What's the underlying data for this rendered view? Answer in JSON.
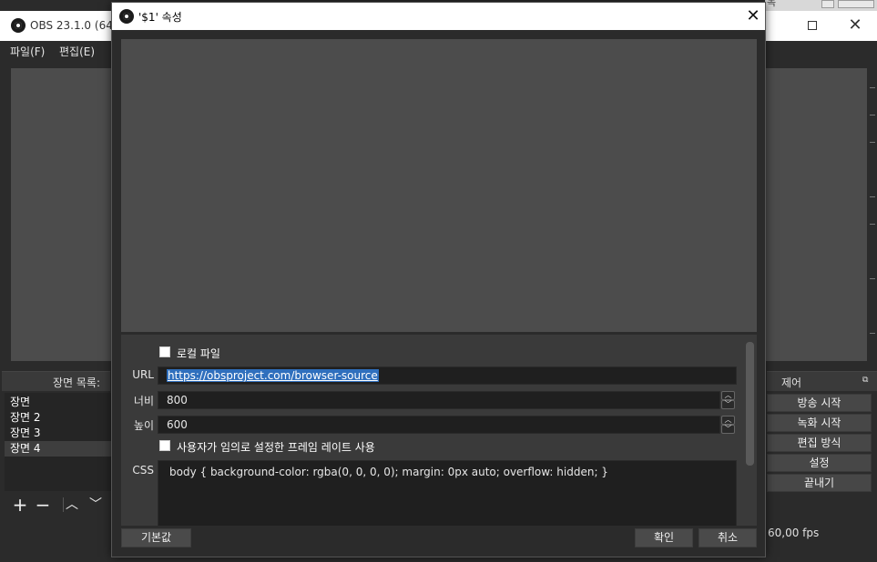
{
  "main_window": {
    "title": "OBS 23.1.0 (64-",
    "menu": [
      "파일(F)",
      "편집(E)"
    ],
    "top_right_partial": "녹",
    "scenes_panel": {
      "title": "장면 목록:",
      "items": [
        "장면",
        "장면 2",
        "장면 3",
        "장면 4"
      ],
      "selected_index": 3,
      "toolbar": {
        "add": "+",
        "remove": "−",
        "up": "︿",
        "down": "﹀"
      }
    },
    "controls_panel": {
      "title": "제어",
      "float_glyph": "⧉",
      "buttons": [
        "방송 시작",
        "녹화 시작",
        "편집 방식",
        "설정",
        "끝내기"
      ]
    },
    "status": {
      "fps": "60,00 fps"
    }
  },
  "dialog": {
    "title": "'$1' 속성",
    "close_glyph": "✕",
    "local_file": {
      "label": "로컬 파일",
      "checked": false
    },
    "url": {
      "label": "URL",
      "value": "https://obsproject.com/browser-source"
    },
    "width": {
      "label": "너비",
      "value": "800"
    },
    "height": {
      "label": "높이",
      "value": "600"
    },
    "custom_fps": {
      "label": "사용자가 임의로 설정한 프레임 레이트 사용",
      "checked": false
    },
    "css": {
      "label": "CSS",
      "value": "body { background-color: rgba(0, 0, 0, 0); margin: 0px auto; overflow: hidden; }"
    },
    "spin_up": "︿",
    "spin_down": "﹀",
    "buttons": {
      "defaults": "기본값",
      "ok": "확인",
      "cancel": "취소"
    }
  },
  "colors": {
    "window_bg": "#2b2b2b",
    "preview_bg": "#4c4c4c",
    "field_bg": "#1f1f1f",
    "selection": "#2f6fbd",
    "button_bg": "#4a4a4a"
  }
}
